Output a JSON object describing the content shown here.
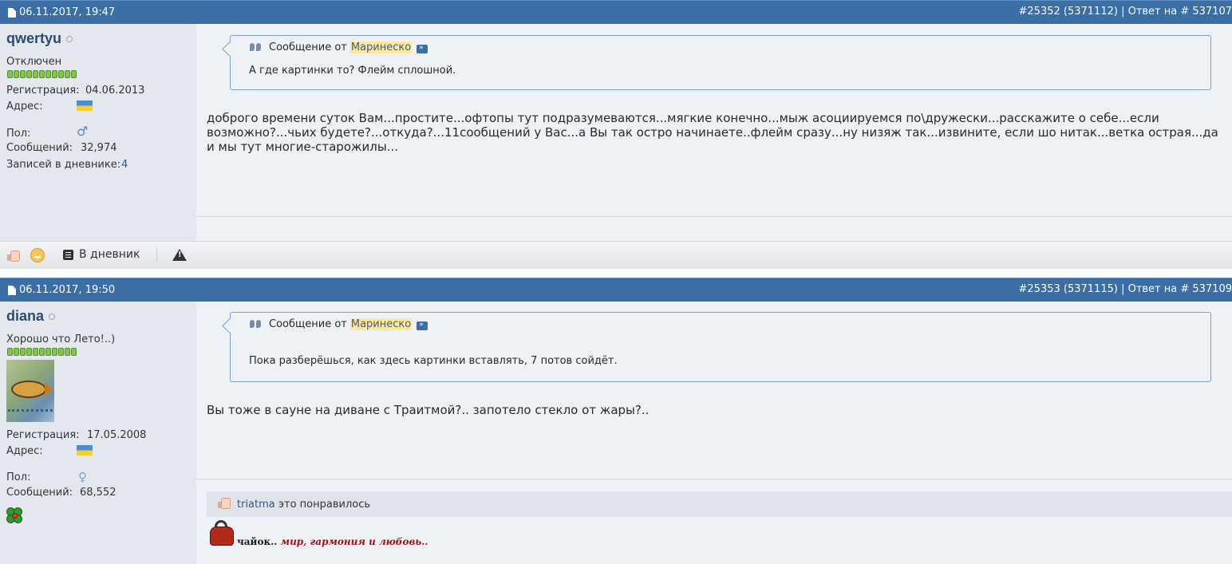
{
  "posts": [
    {
      "date": "06.11.2017, 19:47",
      "post_ref": "#25352 (5371112) | Ответ на # 537107",
      "user": {
        "name": "qwertyu",
        "status": "Отключен",
        "reg_label": "Регистрация:",
        "reg_date": "04.06.2013",
        "addr_label": "Адрес:",
        "gender_label": "Пол:",
        "msgs_label": "Сообщений:",
        "msgs_count": "32,974",
        "diary_label": "Записей в дневнике:",
        "diary_count": "4"
      },
      "quote": {
        "prefix": "Сообщение от",
        "author": "Маринеско",
        "text": "А где картинки то? Флейм сплошной."
      },
      "message": "доброго времени суток Вам...простите...офтопы тут подразумеваются...мягкие конечно...мыж асоциируемся по\\дружески...расскажите о себе...если возможно?...чьих будете?...откуда?...11сообщений у Вас...а Вы так остро начинаете..флейм сразу...ну низяж так...извините, если шо нитак...ветка острая...да и мы тут многие-старожилы..."
    },
    {
      "date": "06.11.2017, 19:50",
      "post_ref": "#25353 (5371115) | Ответ на # 537109",
      "user": {
        "name": "diana",
        "status": "Хорошо что Лето!..)",
        "reg_label": "Регистрация:",
        "reg_date": "17.05.2008",
        "addr_label": "Адрес:",
        "gender_label": "Пол:",
        "msgs_label": "Сообщений:",
        "msgs_count": "68,552"
      },
      "quote": {
        "prefix": "Сообщение от",
        "author": "Маринеско",
        "text": "Пока разберёшься, как здесь картинки вставлять, 7 потов сойдёт."
      },
      "message": "Вы тоже в сауне на диване с Траитмой?.. запотело стекло от жары?..",
      "likes": {
        "user": "triatma",
        "text": "это понравилось"
      },
      "signature": {
        "part1": "чайок..",
        "part2": "мир, гармония и любовь.."
      }
    }
  ],
  "toolbar": {
    "diary_button": "В дневник"
  },
  "icons": {
    "post": "document-icon",
    "quote": "quote-icon",
    "goto": "view-post-icon",
    "like": "thumbs-up-icon",
    "smile": "smile-icon",
    "diary": "diary-icon",
    "report": "warning-icon",
    "male": "male-icon",
    "female": "female-icon",
    "flag": "ukraine-flag-icon",
    "clover": "clover-icon"
  }
}
